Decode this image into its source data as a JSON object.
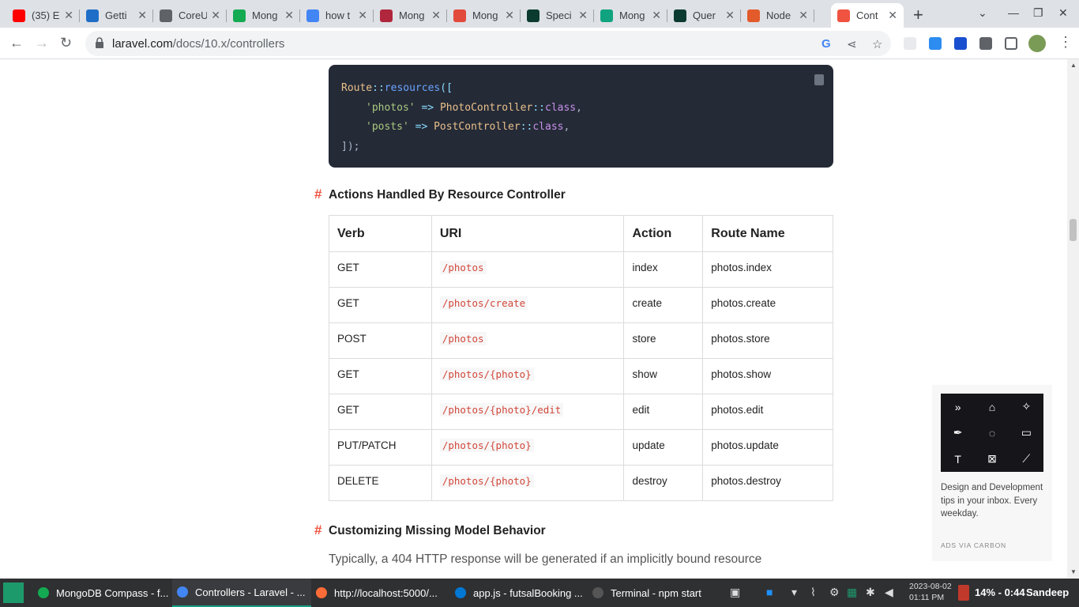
{
  "tabs": [
    {
      "label": "(35) E",
      "color": "#ff0000"
    },
    {
      "label": "Getti",
      "color": "#1e6ec8"
    },
    {
      "label": "CoreU",
      "color": "#5f6368"
    },
    {
      "label": "Mong",
      "color": "#13aa52"
    },
    {
      "label": "how t",
      "color": "#4285f4"
    },
    {
      "label": "Mong",
      "color": "#b0263d"
    },
    {
      "label": "Mong",
      "color": "#e24a3b"
    },
    {
      "label": "Speci",
      "color": "#0b3b2e"
    },
    {
      "label": "Mong",
      "color": "#10a37f"
    },
    {
      "label": "Quer",
      "color": "#0b3b2e"
    },
    {
      "label": "Node",
      "color": "#e35a2b"
    },
    {
      "label": "Cont",
      "color": "#f05340"
    }
  ],
  "toolbar": {
    "url_host": "laravel.com",
    "url_path": "/docs/10.x/controllers"
  },
  "code": {
    "lines": [
      {
        "a": "Route",
        "b": "::",
        "c": "resources",
        "d": "(["
      },
      {
        "key": "'photos'",
        "arrow": " => ",
        "cls": "PhotoController",
        "sep": "::",
        "kw": "class",
        "end": ","
      },
      {
        "key": "'posts'",
        "arrow": " => ",
        "cls": "PostController",
        "sep": "::",
        "kw": "class",
        "end": ","
      },
      {
        "close": "]);"
      }
    ]
  },
  "section1": {
    "hash": "#",
    "title": "Actions Handled By Resource Controller"
  },
  "table": {
    "headers": [
      "Verb",
      "URI",
      "Action",
      "Route Name"
    ],
    "rows": [
      [
        "GET",
        "/photos",
        "index",
        "photos.index"
      ],
      [
        "GET",
        "/photos/create",
        "create",
        "photos.create"
      ],
      [
        "POST",
        "/photos",
        "store",
        "photos.store"
      ],
      [
        "GET",
        "/photos/{photo}",
        "show",
        "photos.show"
      ],
      [
        "GET",
        "/photos/{photo}/edit",
        "edit",
        "photos.edit"
      ],
      [
        "PUT/PATCH",
        "/photos/{photo}",
        "update",
        "photos.update"
      ],
      [
        "DELETE",
        "/photos/{photo}",
        "destroy",
        "photos.destroy"
      ]
    ]
  },
  "section2": {
    "hash": "#",
    "title": "Customizing Missing Model Behavior"
  },
  "paragraph": "Typically, a 404 HTTP response will be generated if an implicitly bound resource",
  "ad": {
    "text": "Design and Development tips in your inbox. Every weekday.",
    "via": "ADS VIA CARBON"
  },
  "taskbar": {
    "apps": [
      {
        "label": "MongoDB Compass - f...",
        "color": "#13aa52"
      },
      {
        "label": "Controllers - Laravel - ...",
        "color": "#4285f4"
      },
      {
        "label": "http://localhost:5000/...",
        "color": "#ff6c37"
      },
      {
        "label": "app.js - futsalBooking ...",
        "color": "#0078d4"
      },
      {
        "label": "Terminal - npm start",
        "color": "#555555"
      }
    ],
    "date": "2023-08-02",
    "time": "01:11 PM",
    "battery": "14% - 0:44",
    "user": "Sandeep"
  }
}
